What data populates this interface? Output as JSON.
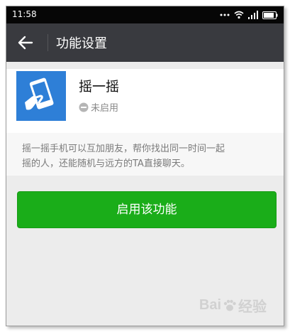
{
  "status_bar": {
    "time": "11:58",
    "icons": [
      "dots-icon",
      "wifi-icon",
      "signal-icon",
      "battery-icon"
    ]
  },
  "app_bar": {
    "title": "功能设置",
    "back_icon": "arrow-left-icon"
  },
  "feature": {
    "name": "摇一摇",
    "status": "未启用",
    "icon": "shake-phone-icon",
    "icon_color": "#2e7fd7"
  },
  "description": {
    "line1": "摇一摇手机可以互加朋友，帮你找出同一时间一起",
    "line2": "摇的人，还能随机与远方的TA直接聊天。"
  },
  "actions": {
    "enable_label": "启用该功能",
    "enable_color": "#1aad19"
  },
  "watermark": {
    "text_a": "Bai",
    "text_b": "经验"
  }
}
